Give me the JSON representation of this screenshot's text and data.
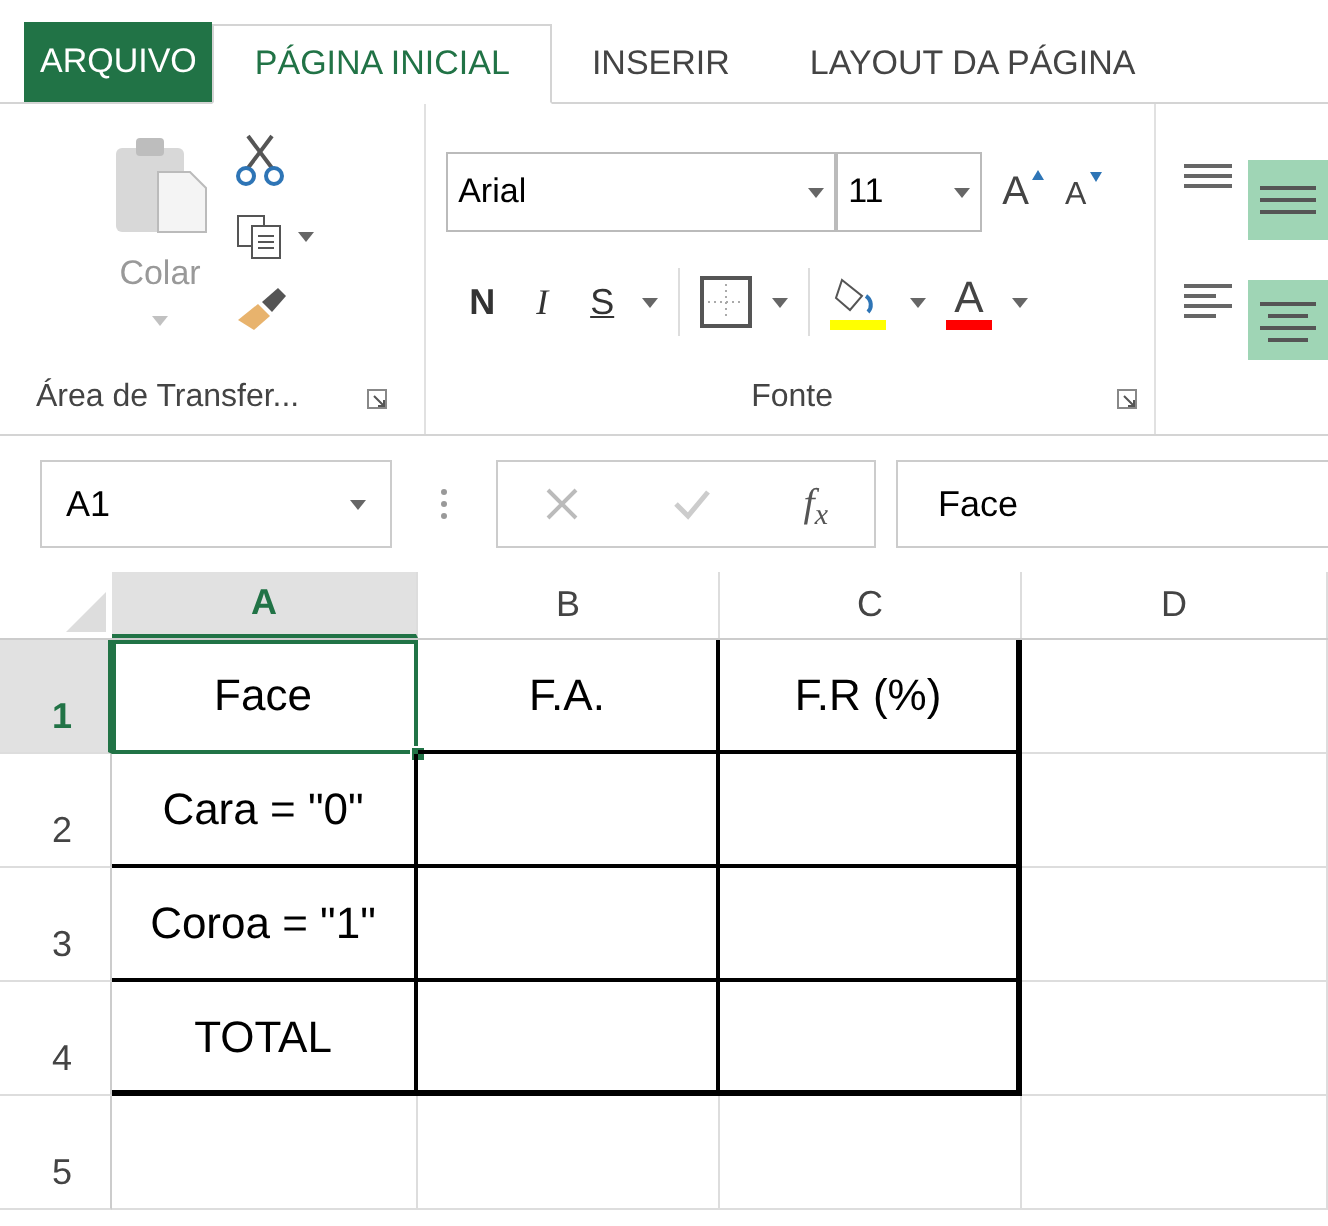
{
  "tabs": [
    {
      "label": "ARQUIVO",
      "kind": "file",
      "selected": false
    },
    {
      "label": "PÁGINA INICIAL",
      "kind": "tab",
      "selected": true
    },
    {
      "label": "INSERIR",
      "kind": "tab",
      "selected": false
    },
    {
      "label": "LAYOUT DA PÁGINA",
      "kind": "tab",
      "selected": false
    }
  ],
  "clipboard": {
    "paste": "Colar",
    "label": "Área de Transfer..."
  },
  "font": {
    "name": "Arial",
    "size": "11",
    "grow": "A",
    "shrink": "A",
    "bold": "N",
    "italic": "I",
    "underline": "S",
    "font_color": "A",
    "label": "Fonte"
  },
  "formula_bar": {
    "name_box": "A1",
    "function_label": "f$_{x}$",
    "value": "Face"
  },
  "grid": {
    "columns": [
      {
        "label": "A",
        "selected": true
      },
      {
        "label": "B",
        "selected": false
      },
      {
        "label": "C",
        "selected": false
      },
      {
        "label": "D",
        "selected": false
      }
    ],
    "rows": [
      {
        "number": "1",
        "selected": true,
        "bordered": true,
        "cells": [
          {
            "text": "Face",
            "selected": true
          },
          {
            "text": "F.A.",
            "selected": false
          },
          {
            "text": "F.R (%)",
            "selected": false
          }
        ]
      },
      {
        "number": "2",
        "selected": false,
        "bordered": true,
        "cells": [
          {
            "text": "Cara = \"0\"",
            "selected": false
          }
        ]
      },
      {
        "number": "3",
        "selected": false,
        "bordered": true,
        "cells": [
          {
            "text": "Coroa = \"1\"",
            "selected": false
          }
        ]
      },
      {
        "number": "4",
        "selected": false,
        "bordered": true,
        "cells": [
          {
            "text": "TOTAL",
            "selected": false
          }
        ]
      },
      {
        "number": "5",
        "selected": false,
        "bordered": false
      }
    ]
  }
}
